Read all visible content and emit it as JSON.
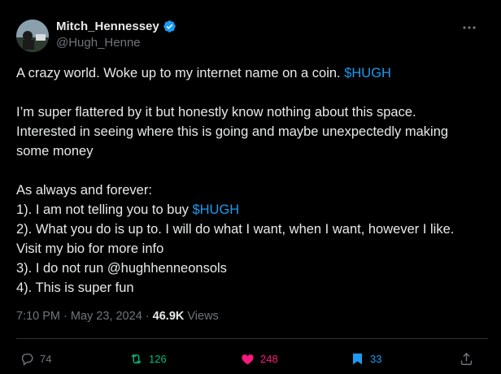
{
  "author": {
    "display_name": "Mitch_Hennessey",
    "handle": "@Hugh_Henne"
  },
  "tweet": {
    "lines": [
      [
        {
          "text": "A crazy world. Woke up to my internet name on a coin. "
        },
        {
          "text": "$HUGH",
          "link": true
        }
      ],
      [],
      [
        {
          "text": "I’m super flattered by it but honestly know nothing about this space."
        }
      ],
      [
        {
          "text": "Interested in seeing where this is going and maybe unexpectedly making"
        }
      ],
      [
        {
          "text": "some money"
        }
      ],
      [],
      [
        {
          "text": "As always and forever:"
        }
      ],
      [
        {
          "text": "1). I am not telling you to buy "
        },
        {
          "text": "$HUGH",
          "link": true
        }
      ],
      [
        {
          "text": "2). What you do is up to. I will do what I want, when I want, however I like."
        }
      ],
      [
        {
          "text": "Visit my bio for more info"
        }
      ],
      [
        {
          "text": "3). I do not run @hughhenneonsols"
        }
      ],
      [
        {
          "text": "4). This is super fun"
        }
      ]
    ]
  },
  "meta": {
    "time": "7:10 PM",
    "separator": " · ",
    "date": "May 23, 2024",
    "views_count": "46.9K",
    "views_label": " Views"
  },
  "actions": {
    "replies": "74",
    "reposts": "126",
    "likes": "248",
    "bookmarks": "33"
  },
  "colors": {
    "background": "#000000",
    "text": "#e7e9ea",
    "secondary": "#71767b",
    "link": "#1d9bf0",
    "repost": "#00ba7c",
    "like": "#f91880",
    "bookmark": "#1d9bf0"
  },
  "icons": [
    "verified-badge-icon",
    "more-options-icon",
    "reply-icon",
    "repost-icon",
    "like-icon",
    "bookmark-icon",
    "share-icon"
  ]
}
